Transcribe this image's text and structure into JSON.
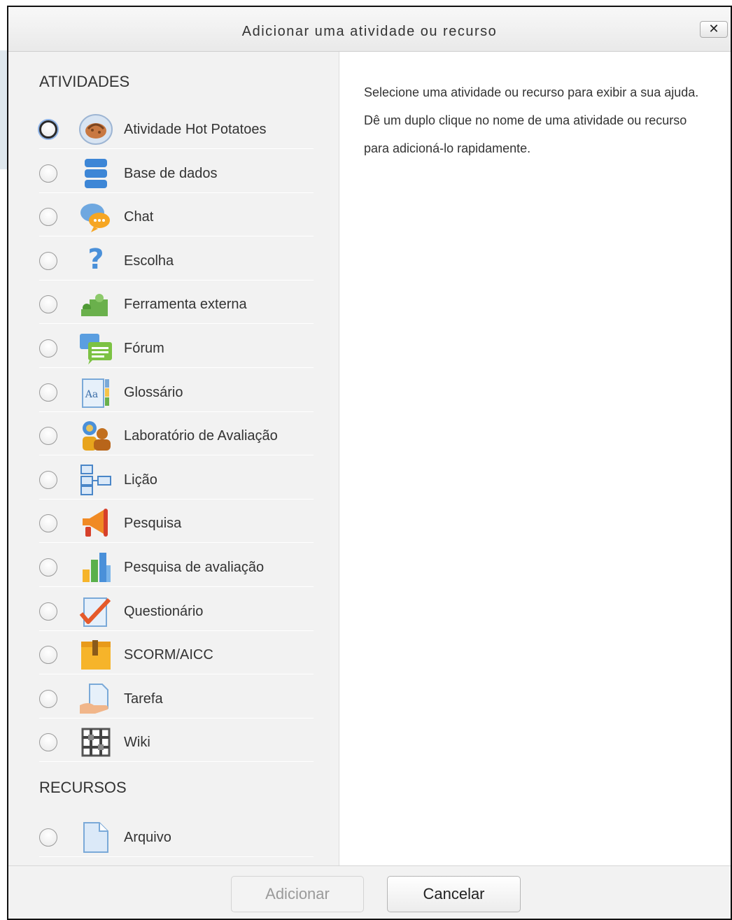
{
  "dialog": {
    "title": "Adicionar uma atividade ou recurso",
    "close_label": "✕"
  },
  "activities": {
    "heading": "ATIVIDADES",
    "items": [
      {
        "label": "Atividade Hot Potatoes",
        "icon": "hot-potatoes-icon",
        "focused": true
      },
      {
        "label": "Base de dados",
        "icon": "database-icon"
      },
      {
        "label": "Chat",
        "icon": "chat-icon"
      },
      {
        "label": "Escolha",
        "icon": "question-mark-icon"
      },
      {
        "label": "Ferramenta externa",
        "icon": "puzzle-icon"
      },
      {
        "label": "Fórum",
        "icon": "forum-icon"
      },
      {
        "label": "Glossário",
        "icon": "glossary-icon"
      },
      {
        "label": "Laboratório de Avaliação",
        "icon": "workshop-icon"
      },
      {
        "label": "Lição",
        "icon": "lesson-icon"
      },
      {
        "label": "Pesquisa",
        "icon": "megaphone-icon"
      },
      {
        "label": "Pesquisa de avaliação",
        "icon": "bar-chart-icon"
      },
      {
        "label": "Questionário",
        "icon": "quiz-icon"
      },
      {
        "label": "SCORM/AICC",
        "icon": "scorm-package-icon"
      },
      {
        "label": "Tarefa",
        "icon": "assignment-icon"
      },
      {
        "label": "Wiki",
        "icon": "wiki-icon"
      }
    ]
  },
  "resources": {
    "heading": "RECURSOS",
    "items": [
      {
        "label": "Arquivo",
        "icon": "file-icon"
      }
    ]
  },
  "help_text": "Selecione uma atividade ou recurso para exibir a sua ajuda. Dê um duplo clique no nome de uma atividade ou recurso para adicioná-lo rapidamente.",
  "footer": {
    "add_label": "Adicionar",
    "cancel_label": "Cancelar"
  },
  "colors": {
    "pane_background": "#f2f2f2",
    "focus_ring": "#8fb4e8",
    "icon_blue": "#3d86d6",
    "icon_orange": "#f08a24"
  }
}
